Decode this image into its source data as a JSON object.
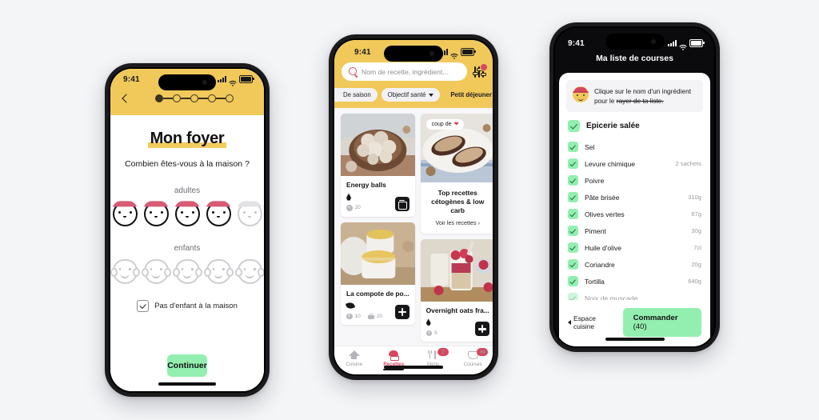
{
  "theme": {
    "yellow": "#f0c95a",
    "green": "#93efb0",
    "red": "#d8455e",
    "page_bg": "#f4f5f7"
  },
  "phone1": {
    "status": {
      "time": "9:41"
    },
    "stepper": {
      "steps": 5,
      "current": 1
    },
    "title": "Mon foyer",
    "question": "Combien êtes-vous à la maison ?",
    "adults": {
      "label": "adultes",
      "total": 5,
      "selected": 4
    },
    "children": {
      "label": "enfants",
      "total": 5,
      "selected": 0
    },
    "checkbox": {
      "label": "Pas d'enfant à la maison",
      "checked": true
    },
    "cta": "Continuer"
  },
  "phone2": {
    "status": {
      "time": "9:41"
    },
    "search": {
      "placeholder": "Nom de recette, ingrédient...",
      "value": ""
    },
    "filters": [
      {
        "label": "De saison",
        "dropdown": false,
        "selected": false
      },
      {
        "label": "Objectif santé",
        "dropdown": true,
        "selected": false
      },
      {
        "label": "Petit déjeuner",
        "dropdown": true,
        "selected": true
      }
    ],
    "cards": [
      {
        "title": "Energy balls",
        "diet_icon": "drop-icon",
        "prep_time": "20",
        "cook_time": null,
        "action": "delete"
      },
      {
        "title": "La compote de po...",
        "diet_icon": "leaf-icon",
        "prep_time": "10",
        "cook_time": "20",
        "action": "add"
      },
      {
        "title": "Overnight oats fra...",
        "diet_icon": "drop-icon",
        "prep_time": "5",
        "cook_time": null,
        "action": "add"
      }
    ],
    "promo": {
      "badge": "coup de",
      "badge_icon": "heart-icon",
      "title": "Top recettes cétogènes & low carb",
      "link": "Voir les recettes ›"
    },
    "tabs": [
      {
        "label": "Cuisine",
        "icon": "home-icon",
        "active": false,
        "badge": null
      },
      {
        "label": "Recettes",
        "icon": "chef-hat-icon",
        "active": true,
        "badge": null
      },
      {
        "label": "Menu",
        "icon": "cutlery-icon",
        "active": false,
        "badge": "7"
      },
      {
        "label": "Courses",
        "icon": "cart-icon",
        "active": false,
        "badge": "49"
      }
    ]
  },
  "phone3": {
    "status": {
      "time": "9:41"
    },
    "title": "Ma liste de courses",
    "tip": {
      "line1": "Clique sur le nom d'un ingrédient",
      "line2_prefix": "pour le ",
      "line2_strike": "rayer de ta liste."
    },
    "section": {
      "label": "Epicerie salée",
      "checked": true
    },
    "items": [
      {
        "name": "Sel",
        "qty": "",
        "checked": true
      },
      {
        "name": "Levure chimique",
        "qty": "2 sachets",
        "checked": true
      },
      {
        "name": "Poivre",
        "qty": "",
        "checked": true
      },
      {
        "name": "Pâte brisée",
        "qty": "310g",
        "checked": true
      },
      {
        "name": "Olives vertes",
        "qty": "67g",
        "checked": true
      },
      {
        "name": "Piment",
        "qty": "30g",
        "checked": true
      },
      {
        "name": "Huile d'olive",
        "qty": "7cl",
        "checked": true
      },
      {
        "name": "Coriandre",
        "qty": "20g",
        "checked": true
      },
      {
        "name": "Tortilla",
        "qty": "640g",
        "checked": true
      },
      {
        "name": "Noix de muscade",
        "qty": "",
        "checked": true
      }
    ],
    "back_link": "Espace cuisine",
    "order_button": {
      "label": "Commander",
      "count": "(40)"
    }
  }
}
